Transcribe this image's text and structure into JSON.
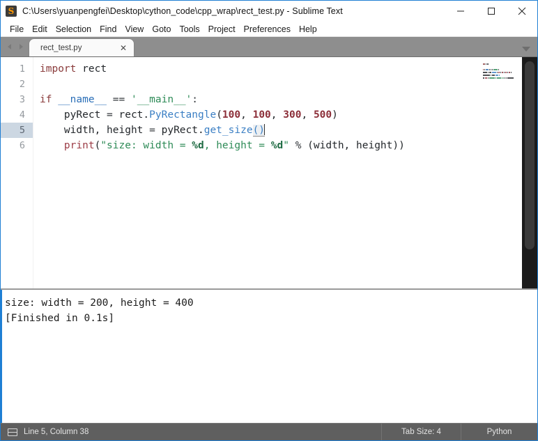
{
  "window": {
    "title": "C:\\Users\\yuanpengfei\\Desktop\\cython_code\\cpp_wrap\\rect_test.py - Sublime Text",
    "app_icon": "sublime-text-icon",
    "icon_glyph": "S",
    "controls": {
      "minimize": "minimize-icon",
      "maximize": "maximize-icon",
      "close": "close-icon"
    },
    "border_color": "#1f7fd4"
  },
  "menubar": {
    "items": [
      {
        "label": "File"
      },
      {
        "label": "Edit"
      },
      {
        "label": "Selection"
      },
      {
        "label": "Find"
      },
      {
        "label": "View"
      },
      {
        "label": "Goto"
      },
      {
        "label": "Tools"
      },
      {
        "label": "Project"
      },
      {
        "label": "Preferences"
      },
      {
        "label": "Help"
      }
    ]
  },
  "tabbar": {
    "nav_prev_icon": "chevron-left-icon",
    "nav_next_icon": "chevron-right-icon",
    "dropdown_icon": "chevron-down-icon",
    "tabs": [
      {
        "label": "rect_test.py",
        "close_glyph": "✕",
        "active": true
      }
    ]
  },
  "editor": {
    "gutter": [
      "1",
      "2",
      "3",
      "4",
      "5",
      "6"
    ],
    "active_line": 5,
    "lines": [
      {
        "n": "1",
        "text": "import rect"
      },
      {
        "n": "2",
        "text": ""
      },
      {
        "n": "3",
        "text": "if __name__ == '__main__':"
      },
      {
        "n": "4",
        "text": "    pyRect = rect.PyRectangle(100, 100, 300, 500)"
      },
      {
        "n": "5",
        "text": "    width, height = pyRect.get_size()"
      },
      {
        "n": "6",
        "text": "    print(\"size: width = %d, height = %d\" % (width, height))"
      }
    ],
    "tokens": {
      "l1": [
        {
          "t": "import",
          "c": "tok-kw"
        },
        {
          "t": " ",
          "c": "tok-plain"
        },
        {
          "t": "rect",
          "c": "tok-plain"
        }
      ],
      "l3": [
        {
          "t": "if",
          "c": "tok-kw"
        },
        {
          "t": " ",
          "c": "tok-plain"
        },
        {
          "t": "__name__",
          "c": "tok-var"
        },
        {
          "t": " ",
          "c": "tok-plain"
        },
        {
          "t": "==",
          "c": "tok-op"
        },
        {
          "t": " ",
          "c": "tok-plain"
        },
        {
          "t": "'__main__'",
          "c": "tok-str"
        },
        {
          "t": ":",
          "c": "tok-op"
        }
      ],
      "l4": [
        {
          "t": "    pyRect ",
          "c": "tok-plain"
        },
        {
          "t": "=",
          "c": "tok-op"
        },
        {
          "t": " rect.",
          "c": "tok-plain"
        },
        {
          "t": "PyRectangle",
          "c": "tok-fn"
        },
        {
          "t": "(",
          "c": "tok-plain"
        },
        {
          "t": "100",
          "c": "tok-num"
        },
        {
          "t": ", ",
          "c": "tok-plain"
        },
        {
          "t": "100",
          "c": "tok-num"
        },
        {
          "t": ", ",
          "c": "tok-plain"
        },
        {
          "t": "300",
          "c": "tok-num"
        },
        {
          "t": ", ",
          "c": "tok-plain"
        },
        {
          "t": "500",
          "c": "tok-num"
        },
        {
          "t": ")",
          "c": "tok-plain"
        }
      ],
      "l5": [
        {
          "t": "    width, height ",
          "c": "tok-plain"
        },
        {
          "t": "=",
          "c": "tok-op"
        },
        {
          "t": " pyRect.",
          "c": "tok-plain"
        },
        {
          "t": "get_size",
          "c": "tok-fn"
        },
        {
          "t": "()",
          "c": "tok-paren-hl"
        }
      ],
      "l6": [
        {
          "t": "    ",
          "c": "tok-plain"
        },
        {
          "t": "print",
          "c": "tok-kw2"
        },
        {
          "t": "(",
          "c": "tok-plain"
        },
        {
          "t": "\"size: width = ",
          "c": "tok-str"
        },
        {
          "t": "%d",
          "c": "tok-fmt"
        },
        {
          "t": ", height = ",
          "c": "tok-str"
        },
        {
          "t": "%d",
          "c": "tok-fmt"
        },
        {
          "t": "\"",
          "c": "tok-str"
        },
        {
          "t": " ",
          "c": "tok-plain"
        },
        {
          "t": "%",
          "c": "tok-op"
        },
        {
          "t": " (width, height))",
          "c": "tok-plain"
        }
      ]
    }
  },
  "output_panel": {
    "lines": [
      "size: width = 200, height = 400",
      "[Finished in 0.1s]"
    ]
  },
  "statusbar": {
    "sidebar_toggle_icon": "sidebar-toggle-icon",
    "position": "Line 5, Column 38",
    "tab_size": "Tab Size: 4",
    "syntax": "Python"
  }
}
